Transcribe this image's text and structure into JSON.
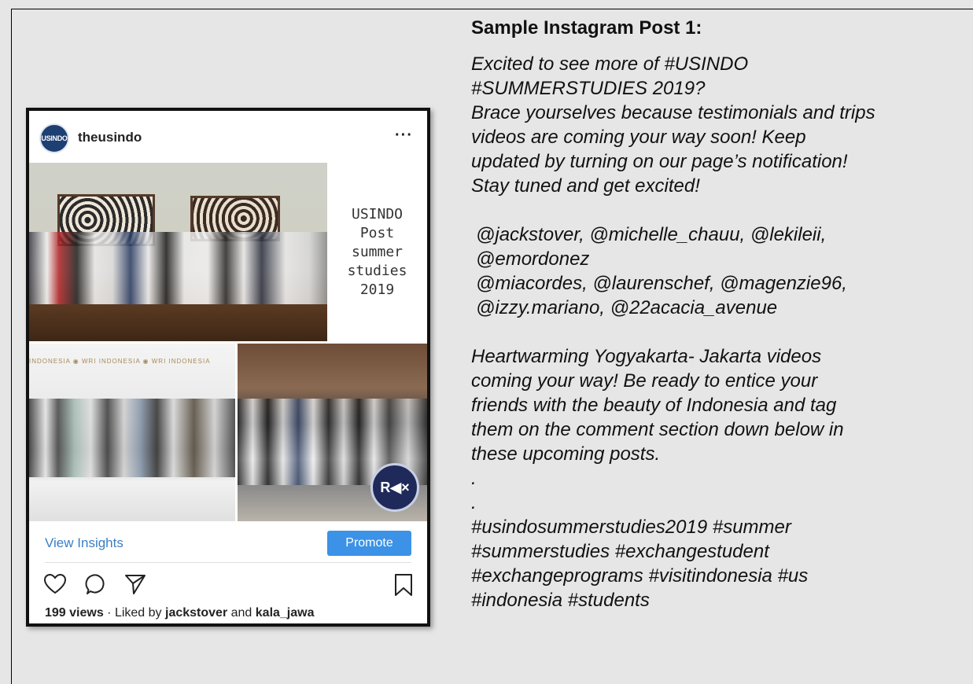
{
  "heading": "Sample Instagram Post 1:",
  "post": {
    "username": "theusindo",
    "avatar_text": "USINDO",
    "more_label": "···",
    "caption_lines": [
      "USINDO",
      "Post",
      "summer",
      "studies",
      "2019"
    ],
    "banner_text": "INDONESIA   ◉ WRI INDONESIA   ◉ WRI INDONESIA",
    "reel_badge": "R◀×",
    "view_insights": "View Insights",
    "promote": "Promote",
    "views": "199 views",
    "liked_by_prefix": " · Liked by ",
    "liked_user1": "jackstover",
    "liked_and": " and ",
    "liked_user2": "kala_jawa"
  },
  "caption": {
    "lines1": [
      "Excited to see more of #USINDO",
      "#SUMMERSTUDIES 2019?",
      "Brace yourselves because testimonials and trips",
      "videos are coming your way soon! Keep",
      "updated by turning on our page’s notification!",
      "Stay tuned and get excited!"
    ],
    "handles": [
      "@jackstover, @michelle_chauu, @lekileii,",
      "@emordonez",
      "@miacordes, @laurenschef, @magenzie96,",
      "@izzy.mariano, @22acacia_avenue"
    ],
    "lines2": [
      "Heartwarming Yogyakarta- Jakarta videos",
      "coming your way! Be ready to entice your",
      "friends with the beauty of Indonesia and tag",
      "them on the comment section down below in",
      "these upcoming posts.",
      ".",
      "."
    ],
    "hashtags": [
      "#usindosummerstudies2019 #summer",
      "#summerstudies #exchangestudent",
      "#exchangeprograms #visitindonesia #us",
      "#indonesia #students"
    ]
  }
}
